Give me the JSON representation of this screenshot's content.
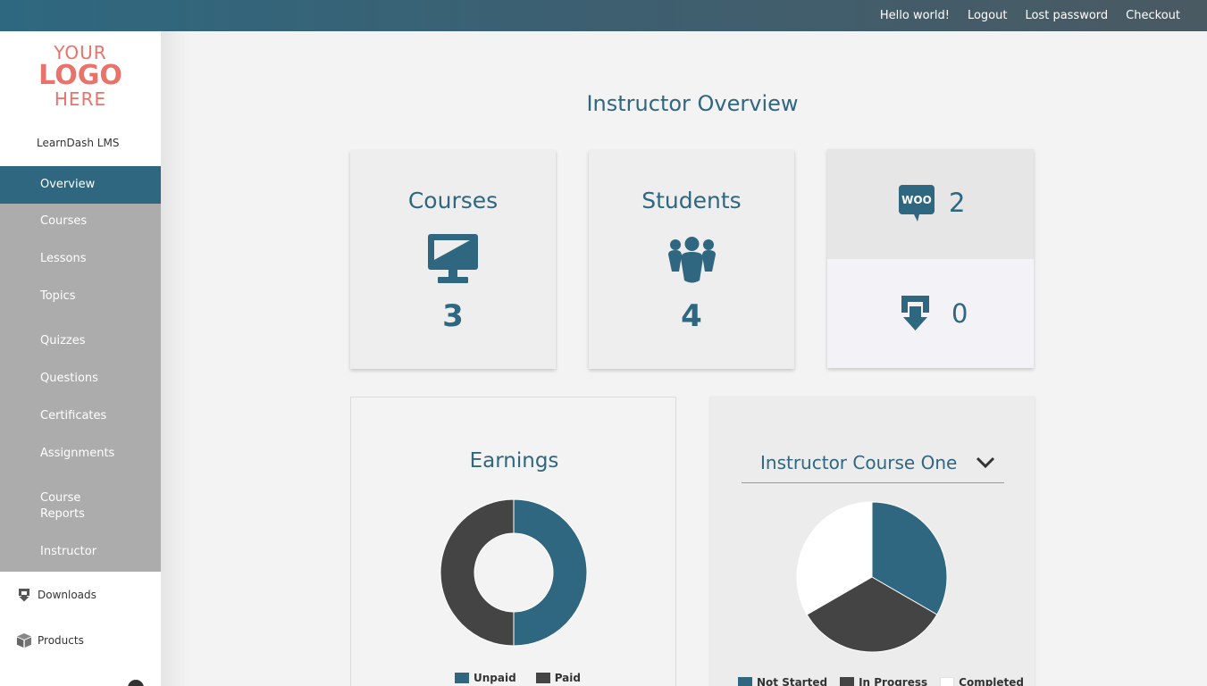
{
  "topbar": {
    "links": [
      "Hello world!",
      "Logout",
      "Lost password",
      "Checkout"
    ]
  },
  "logo": {
    "line1": "YOUR",
    "line2": "LOGO",
    "line3": "HERE"
  },
  "site_name": "LearnDash LMS",
  "menu": {
    "active": "Overview",
    "items": [
      "Courses",
      "Lessons",
      "Topics",
      "Quizzes",
      "Questions",
      "Certificates",
      "Assignments",
      "Course Reports",
      "Instructor"
    ]
  },
  "bottom_nav": {
    "downloads": "Downloads",
    "products": "Products"
  },
  "page_title": "Instructor Overview",
  "stats": {
    "courses_label": "Courses",
    "courses_value": "3",
    "students_label": "Students",
    "students_value": "4",
    "woo_badge": "WOO",
    "woo_value": "2",
    "downloads_value": "0"
  },
  "earnings": {
    "title": "Earnings",
    "legend": [
      "Unpaid",
      "Paid"
    ]
  },
  "course_progress": {
    "selected_course": "Instructor Course One",
    "legend": [
      "Not Started",
      "In Progress",
      "Completed"
    ]
  },
  "colors": {
    "accent": "#2f6780",
    "dark": "#444444",
    "light": "#ffffff",
    "sidebar_menu": "#acacac",
    "logo": "#e9726b"
  },
  "chart_data": [
    {
      "type": "pie",
      "title": "Earnings",
      "donut": true,
      "categories": [
        "Unpaid",
        "Paid"
      ],
      "values": [
        50,
        50
      ],
      "colors": [
        "#2f6780",
        "#444444"
      ]
    },
    {
      "type": "pie",
      "title": "Instructor Course One",
      "categories": [
        "Not Started",
        "In Progress",
        "Completed"
      ],
      "values": [
        33.3,
        33.3,
        33.3
      ],
      "colors": [
        "#2f6780",
        "#444444",
        "#ffffff"
      ]
    }
  ]
}
